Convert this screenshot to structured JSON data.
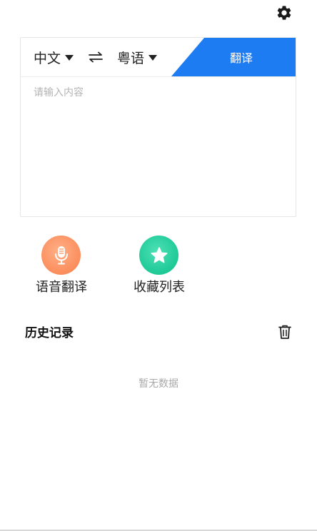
{
  "header": {
    "settings_icon": "gear-icon"
  },
  "translator": {
    "source_lang": "中文",
    "target_lang": "粤语",
    "swap_icon": "swap-arrows-icon",
    "translate_label": "翻译",
    "input": {
      "value": "",
      "placeholder": "请输入内容"
    },
    "accent_color": "#1e7cf2"
  },
  "actions": [
    {
      "label": "语音翻译",
      "icon": "microphone-icon",
      "color": "#fb8d5c"
    },
    {
      "label": "收藏列表",
      "icon": "star-icon",
      "color": "#1ec996"
    }
  ],
  "history": {
    "title": "历史记录",
    "clear_icon": "trash-icon",
    "empty_text": "暂无数据"
  }
}
